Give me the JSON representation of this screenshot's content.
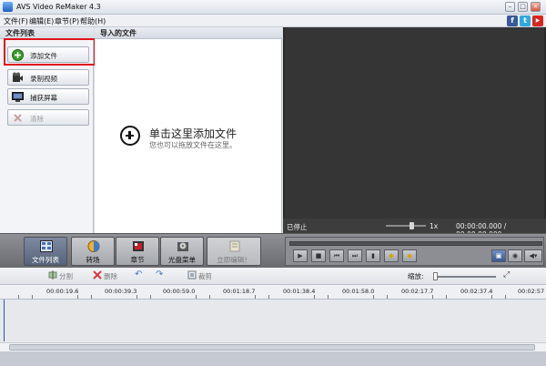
{
  "window": {
    "title": "AVS Video ReMaker 4.3",
    "minimize": "–",
    "maximize": "□",
    "close": "×"
  },
  "menu": [
    "文件(F)",
    "编辑(E)",
    "章节(P)",
    "帮助(H)"
  ],
  "social": {
    "facebook": "f",
    "twitter": "t",
    "youtube": "▶"
  },
  "file_list": {
    "header": "文件列表",
    "buttons": [
      {
        "label": "添加文件",
        "icon": "add-circle-icon",
        "enabled": true
      },
      {
        "label": "录制视频",
        "icon": "camera-icon",
        "enabled": true
      },
      {
        "label": "捕获屏幕",
        "icon": "screen-icon",
        "enabled": true
      },
      {
        "label": "清除",
        "icon": "clear-icon",
        "enabled": false
      }
    ]
  },
  "imported": {
    "header": "导入的文件",
    "click_hint": "单击这里添加文件",
    "drag_hint": "您也可以拖放文件在这里。"
  },
  "preview": {
    "status": "已停止",
    "speed": "1x",
    "time": "00:00:00.000 / 00:00:00.000"
  },
  "toolbar": [
    {
      "label": "文件列表",
      "icon": "file-list-icon",
      "active": true
    },
    {
      "label": "转场",
      "icon": "transition-icon",
      "active": false
    },
    {
      "label": "章节",
      "icon": "chapter-icon",
      "active": false
    },
    {
      "label": "光盘菜单",
      "icon": "disc-menu-icon",
      "active": false
    },
    {
      "label": "立即编辑！",
      "icon": "edit-now-icon",
      "active": false
    }
  ],
  "player_controls": [
    "play-icon",
    "stop-icon",
    "prev-icon",
    "next-icon",
    "frame-icon",
    "marker-in-icon",
    "marker-out-icon"
  ],
  "edit_toolbar": {
    "split": "分割",
    "delete": "删除",
    "trim": "裁剪",
    "zoom_label": "缩放:"
  },
  "ruler": [
    "00:00:19.6",
    "00:00:39.3",
    "00:00:59.0",
    "00:01:18.7",
    "00:01:38.4",
    "00:01:58.0",
    "00:02:17.7",
    "00:02:37.4",
    "00:02:57"
  ],
  "colors": {
    "accent_red": "#e0141b",
    "preview_bg": "#353535",
    "toolbar": "#7d7f84"
  }
}
